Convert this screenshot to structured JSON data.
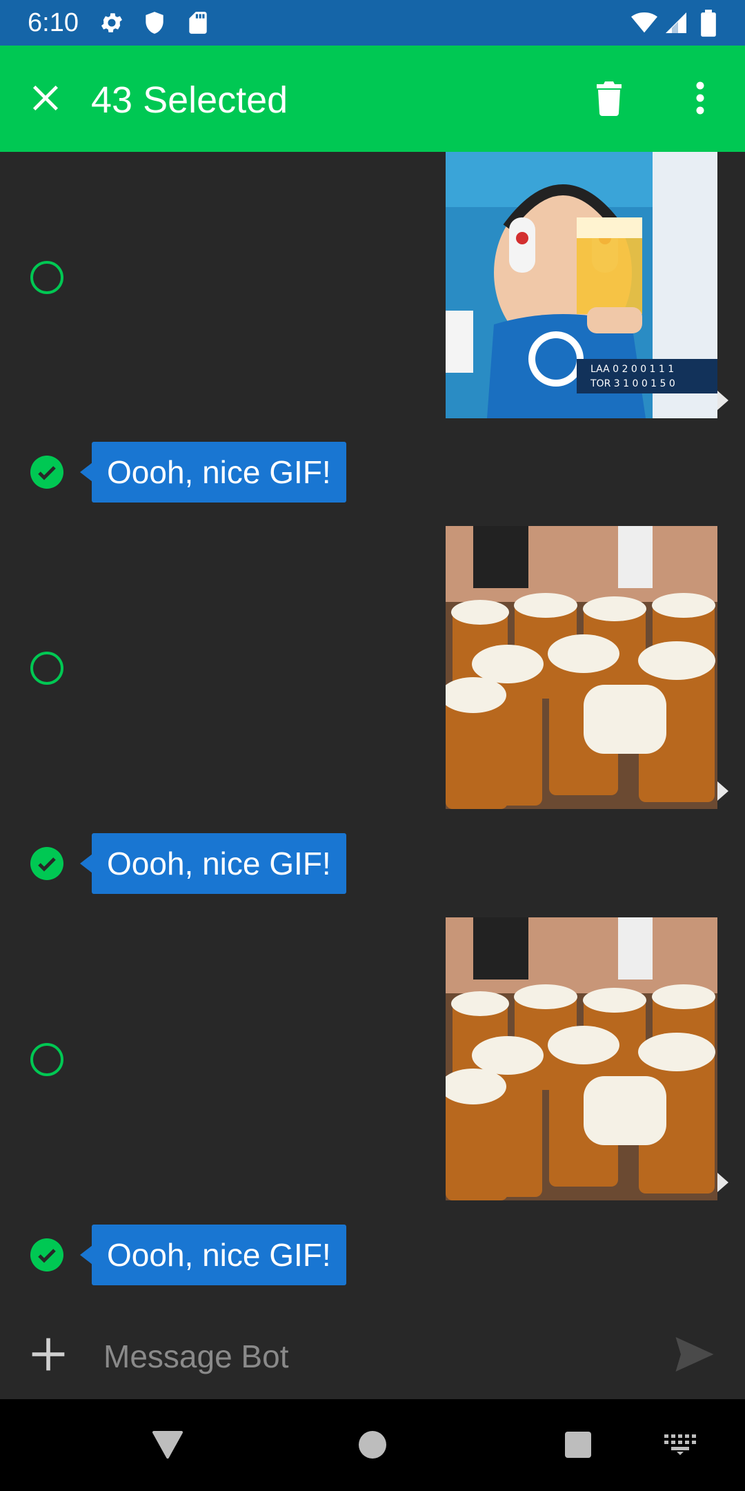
{
  "status_bar": {
    "time": "6:10",
    "left_icons": [
      "settings-gear-icon",
      "shield-icon",
      "sd-card-icon"
    ],
    "right_icons": [
      "wifi-icon",
      "cell-signal-icon",
      "battery-icon"
    ],
    "background_color": "#1565a8"
  },
  "action_bar": {
    "title": "43 Selected",
    "close_icon": "close-icon",
    "delete_icon": "delete-icon",
    "overflow_icon": "more-vert-icon",
    "background_color": "#00c853"
  },
  "messages": [
    {
      "type": "gif",
      "selected": false,
      "content": "baby with ear muffs holding beer at baseball game, scoreboard LAA vs TOR"
    },
    {
      "type": "text",
      "selected": true,
      "text": "Oooh, nice GIF!"
    },
    {
      "type": "gif",
      "selected": false,
      "content": "beer steins"
    },
    {
      "type": "text",
      "selected": true,
      "text": "Oooh, nice GIF!"
    },
    {
      "type": "gif",
      "selected": false,
      "content": "beer steins"
    },
    {
      "type": "text",
      "selected": true,
      "text": "Oooh, nice GIF!"
    }
  ],
  "composer": {
    "placeholder": "Message Bot",
    "value": "",
    "attach_icon": "plus-icon",
    "send_icon": "send-icon"
  },
  "nav_bar": {
    "buttons": [
      "back-icon",
      "home-icon",
      "recents-icon",
      "keyboard-icon"
    ]
  },
  "colors": {
    "accent": "#00c853",
    "bubble": "#1976d2",
    "background": "#282828"
  }
}
